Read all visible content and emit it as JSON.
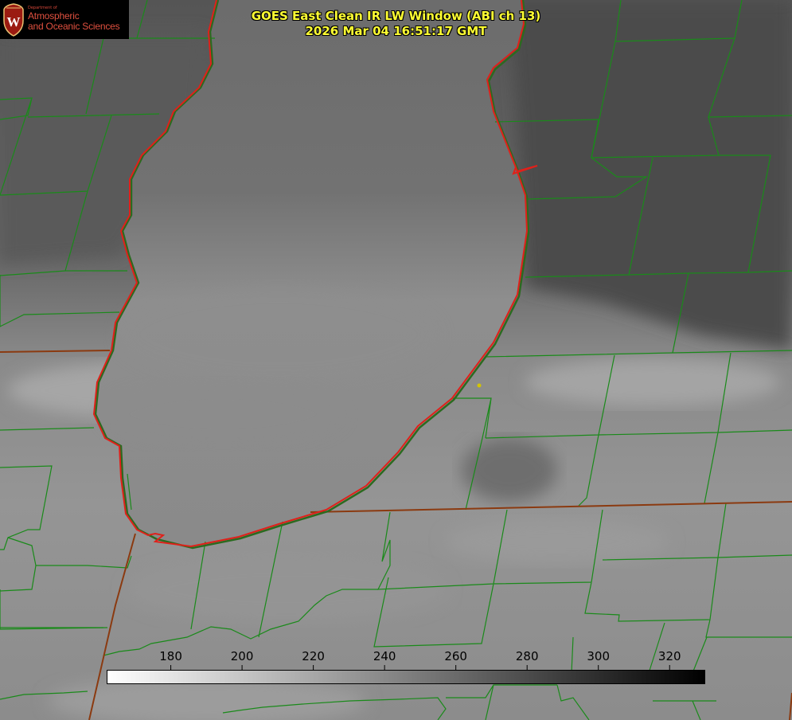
{
  "title": {
    "line1": "GOES East Clean IR LW Window (ABI ch 13)",
    "line2": "2026 Mar 04 16:51:17 GMT"
  },
  "logo": {
    "dept": "Department of",
    "line1": "Atmospheric",
    "line2": "and Oceanic Sciences",
    "icon": "uw-crest-icon"
  },
  "colorbar": {
    "ticks": [
      "180",
      "200",
      "220",
      "240",
      "260",
      "280",
      "300",
      "320"
    ],
    "range": [
      162,
      330
    ],
    "start_color": "#ffffff",
    "end_color": "#000000"
  },
  "map": {
    "lake_outline_color": "#e0201a",
    "boundary_color": "#1a8a1a",
    "state_border_color": "#8b3a10",
    "marker_color": "#d4c400"
  }
}
